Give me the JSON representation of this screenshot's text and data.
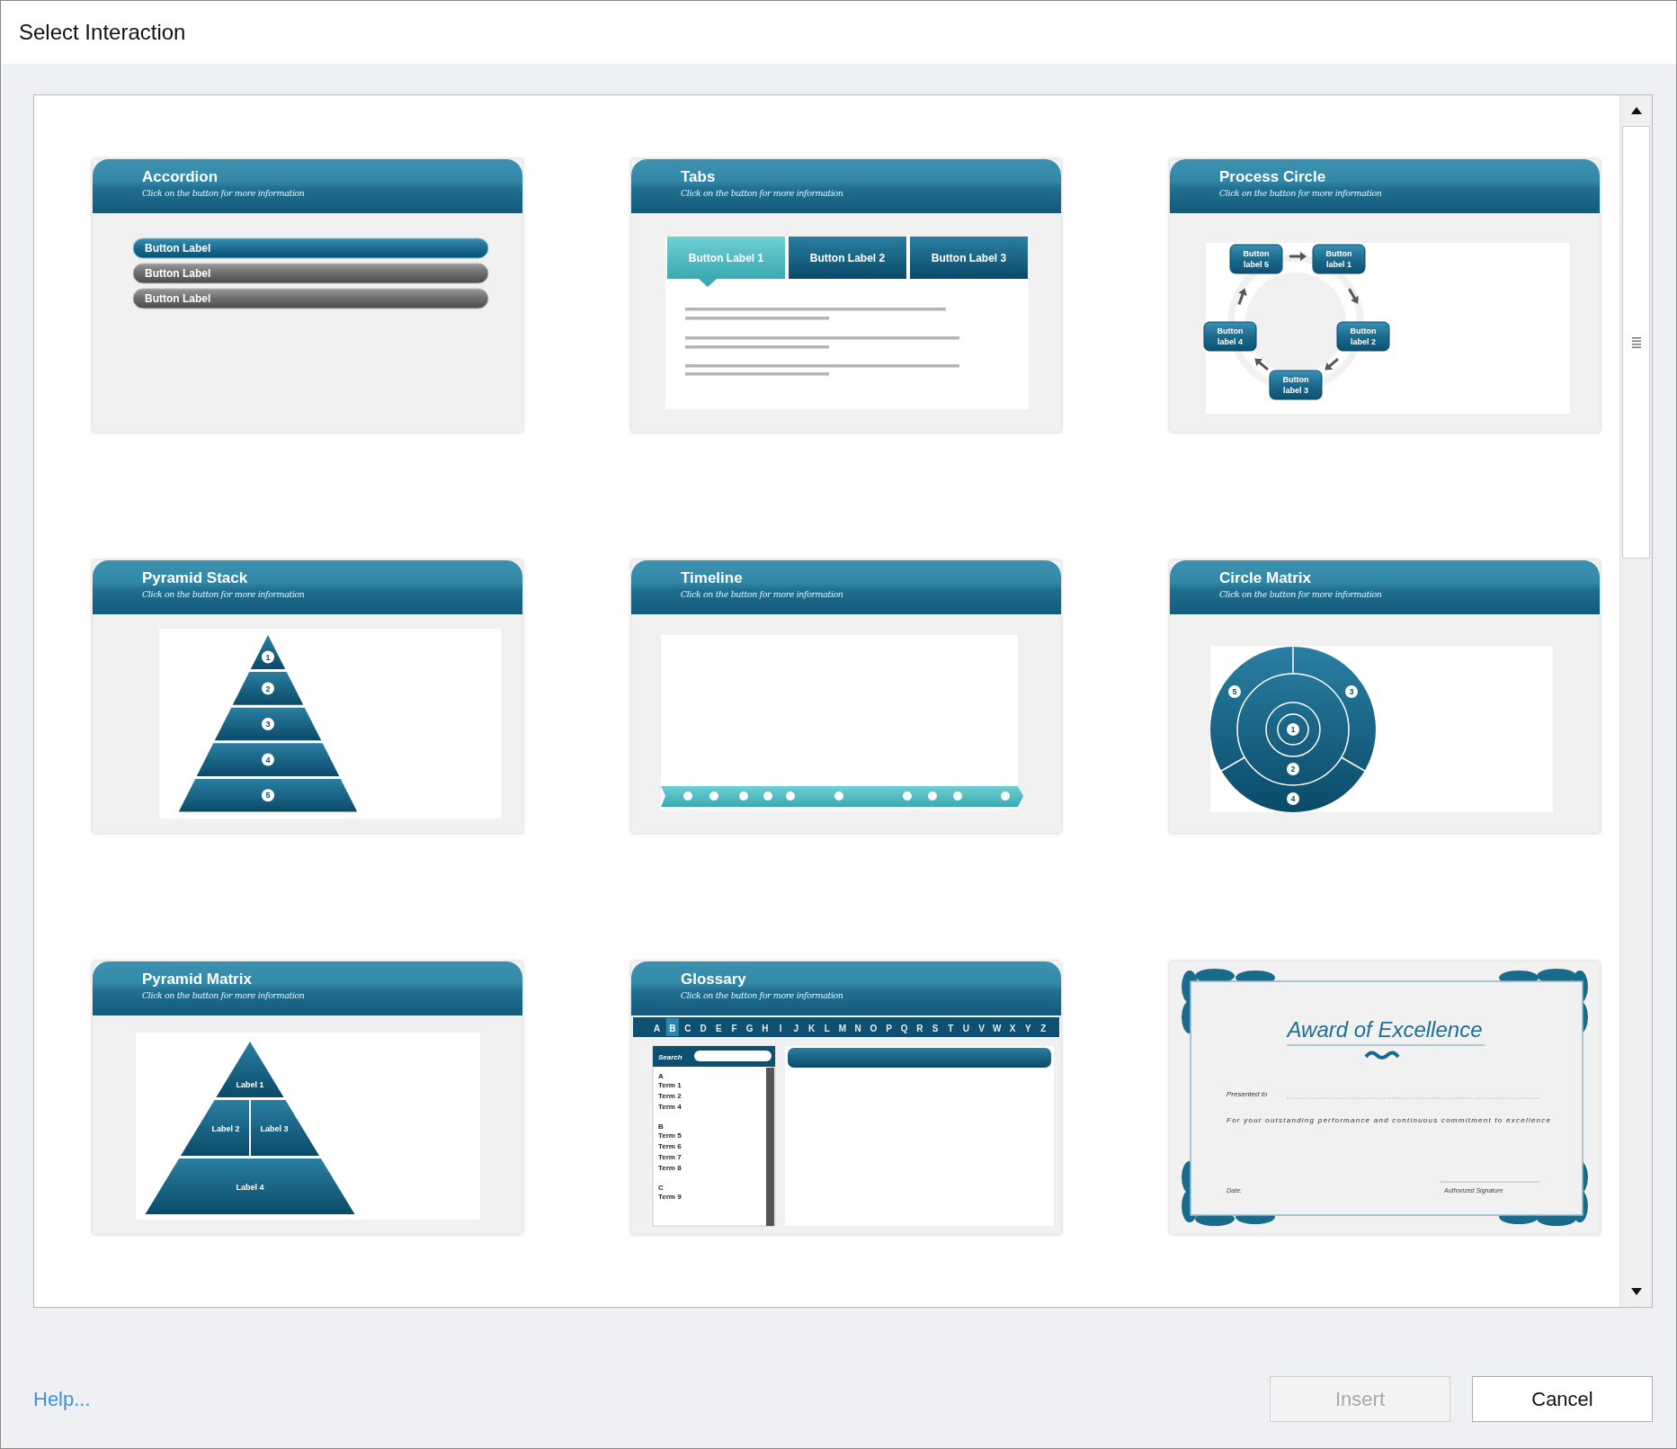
{
  "window": {
    "title": "Select Interaction"
  },
  "interactions": [
    {
      "kind": "accordion",
      "title": "Accordion",
      "subtitle": "Click on the button for more information",
      "selected": false,
      "items": [
        {
          "label": "Button Label",
          "selected": true
        },
        {
          "label": "Button Label",
          "selected": false
        },
        {
          "label": "Button Label",
          "selected": false
        }
      ]
    },
    {
      "kind": "tabs",
      "title": "Tabs",
      "subtitle": "Click on the button for more information",
      "selected": false,
      "tabs": [
        {
          "label": "Button Label 1",
          "selected": true
        },
        {
          "label": "Button Label 2",
          "selected": false
        },
        {
          "label": "Button Label 3",
          "selected": false
        }
      ]
    },
    {
      "kind": "process_circle",
      "title": "Process Circle",
      "subtitle": "Click on the button for more information",
      "selected": false,
      "steps": [
        "Button label 1",
        "Button label 2",
        "Button label 3",
        "Button label 4",
        "Button label 5"
      ]
    },
    {
      "kind": "pyramid_stack",
      "title": "Pyramid Stack",
      "subtitle": "Click on the button for more information",
      "selected": false,
      "levels": [
        "1",
        "2",
        "3",
        "4",
        "5"
      ]
    },
    {
      "kind": "timeline",
      "title": "Timeline",
      "subtitle": "Click on the button for more information",
      "selected": false
    },
    {
      "kind": "circle_matrix",
      "title": "Circle Matrix",
      "subtitle": "Click on the button for more information",
      "selected": false,
      "markers": [
        "1",
        "2",
        "3",
        "4",
        "5"
      ]
    },
    {
      "kind": "pyramid_matrix",
      "title": "Pyramid Matrix",
      "subtitle": "Click on the button for more information",
      "selected": false,
      "labels": [
        "Label 1",
        "Label 2",
        "Label 3",
        "Label 4"
      ]
    },
    {
      "kind": "glossary",
      "title": "Glossary",
      "subtitle": "Click on the button for more information",
      "selected": false,
      "letters": [
        {
          "text": "A",
          "selected": false
        },
        {
          "text": "B",
          "selected": true
        },
        {
          "text": "C",
          "selected": false
        },
        {
          "text": "D",
          "selected": false
        },
        {
          "text": "E",
          "selected": false
        },
        {
          "text": "F",
          "selected": false
        },
        {
          "text": "G",
          "selected": false
        },
        {
          "text": "H",
          "selected": false
        },
        {
          "text": "I",
          "selected": false
        },
        {
          "text": "J",
          "selected": false
        },
        {
          "text": "K",
          "selected": false
        },
        {
          "text": "L",
          "selected": false
        },
        {
          "text": "M",
          "selected": false
        },
        {
          "text": "N",
          "selected": false
        },
        {
          "text": "O",
          "selected": false
        },
        {
          "text": "P",
          "selected": false
        },
        {
          "text": "Q",
          "selected": false
        },
        {
          "text": "R",
          "selected": false
        },
        {
          "text": "S",
          "selected": false
        },
        {
          "text": "T",
          "selected": false
        },
        {
          "text": "U",
          "selected": false
        },
        {
          "text": "V",
          "selected": false
        },
        {
          "text": "W",
          "selected": false
        },
        {
          "text": "X",
          "selected": false
        },
        {
          "text": "Y",
          "selected": false
        },
        {
          "text": "Z",
          "selected": false
        }
      ],
      "search_label": "Search",
      "entries": [
        {
          "kind": "letter",
          "text": "A"
        },
        {
          "kind": "term",
          "text": "Term 1"
        },
        {
          "kind": "term",
          "text": "Term 2"
        },
        {
          "kind": "term",
          "text": "Term 4"
        },
        {
          "kind": "letter",
          "text": "B"
        },
        {
          "kind": "term",
          "text": "Term 5"
        },
        {
          "kind": "term",
          "text": "Term 6"
        },
        {
          "kind": "term",
          "text": "Term 7"
        },
        {
          "kind": "term",
          "text": "Term 8"
        },
        {
          "kind": "letter",
          "text": "C"
        },
        {
          "kind": "term",
          "text": "Term 9"
        }
      ]
    },
    {
      "kind": "certificate",
      "selected": false,
      "certificate": {
        "heading": "Award of Excellence",
        "presented": "Presented to",
        "citation": "For your outstanding performance and continuous commitment to excellence",
        "date": "Date:",
        "signature": "Authorized Signature"
      }
    }
  ],
  "help_link": "Help...",
  "buttons": [
    {
      "label": "Insert",
      "disabled": true
    },
    {
      "label": "Cancel",
      "disabled": false
    }
  ]
}
